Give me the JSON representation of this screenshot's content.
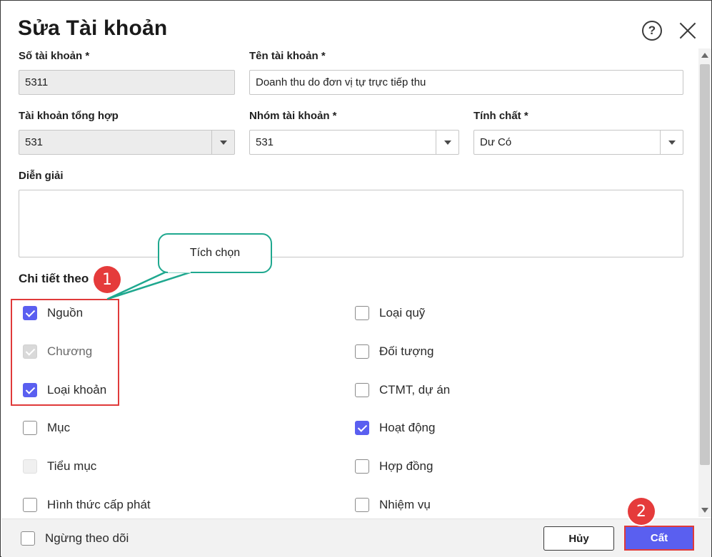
{
  "dialog": {
    "title": "Sửa Tài khoản"
  },
  "fields": {
    "account_no_label": "Số tài khoản *",
    "account_no_value": "5311",
    "account_name_label": "Tên tài khoản *",
    "account_name_value": "Doanh thu do đơn vị tự trực tiếp thu",
    "parent_account_label": "Tài khoản tổng hợp",
    "parent_account_value": "531",
    "group_label": "Nhóm tài khoản *",
    "group_value": "531",
    "nature_label": "Tính chất *",
    "nature_value": "Dư Có",
    "description_label": "Diễn giải",
    "description_value": ""
  },
  "details": {
    "section_label": "Chi tiết theo",
    "left": [
      {
        "label": "Nguồn",
        "state": "checked"
      },
      {
        "label": "Chương",
        "state": "disabled-checked"
      },
      {
        "label": "Loại khoản",
        "state": "checked"
      },
      {
        "label": "Mục",
        "state": "unchecked"
      },
      {
        "label": "Tiểu mục",
        "state": "disabled"
      },
      {
        "label": "Hình thức cấp phát",
        "state": "unchecked"
      }
    ],
    "right": [
      {
        "label": "Loại quỹ",
        "state": "unchecked"
      },
      {
        "label": "Đối tượng",
        "state": "unchecked"
      },
      {
        "label": "CTMT, dự án",
        "state": "unchecked"
      },
      {
        "label": "Hoạt động",
        "state": "checked"
      },
      {
        "label": "Hợp đồng",
        "state": "unchecked"
      },
      {
        "label": "Nhiệm vụ",
        "state": "unchecked"
      }
    ]
  },
  "footer": {
    "stop_tracking_label": "Ngừng theo dõi",
    "cancel_label": "Hủy",
    "save_label": "Cất"
  },
  "annotations": {
    "callout_text": "Tích chọn",
    "badge_1": "1",
    "badge_2": "2"
  },
  "colors": {
    "accent": "#5a5ff0",
    "highlight": "#e03a3a",
    "callout_border": "#1fa88f"
  }
}
